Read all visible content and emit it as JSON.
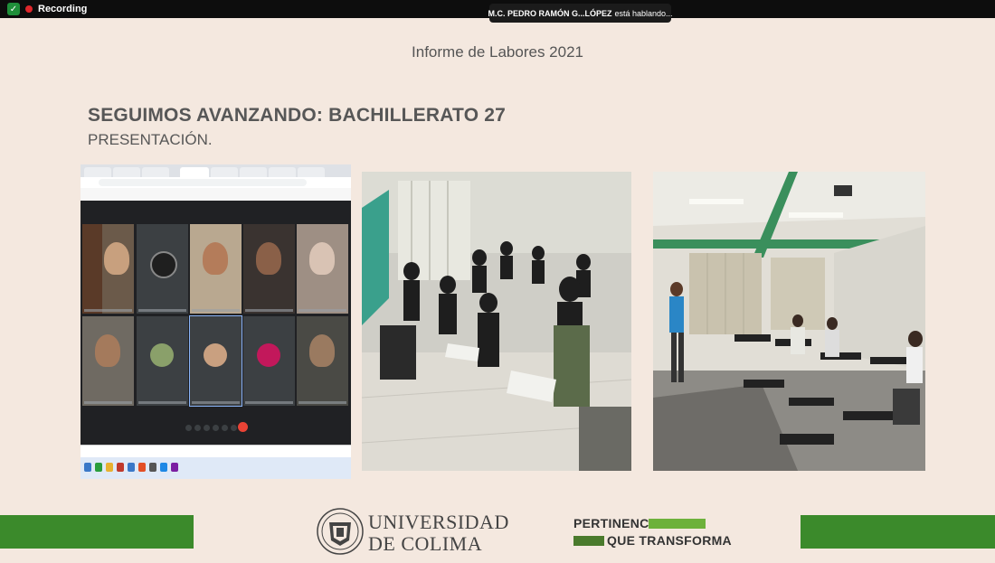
{
  "meeting": {
    "recording_label": "Recording",
    "speaker_name": "M.C. PEDRO RAMÓN G...LÓPEZ",
    "speaker_status": "está hablando..."
  },
  "slide": {
    "header": "Informe de Labores 2021",
    "title": "SEGUIMOS AVANZANDO: BACHILLERATO 27",
    "subtitle": "PRESENTACIÓN."
  },
  "footer": {
    "university_line1": "UNIVERSIDAD",
    "university_line2": "DE COLIMA",
    "slogan_line1": "PERTINENCIA",
    "slogan_line2": "QUE TRANSFORMA",
    "bar_color": "#3b8a2b",
    "slogan_bar_color": "#6db13b"
  }
}
